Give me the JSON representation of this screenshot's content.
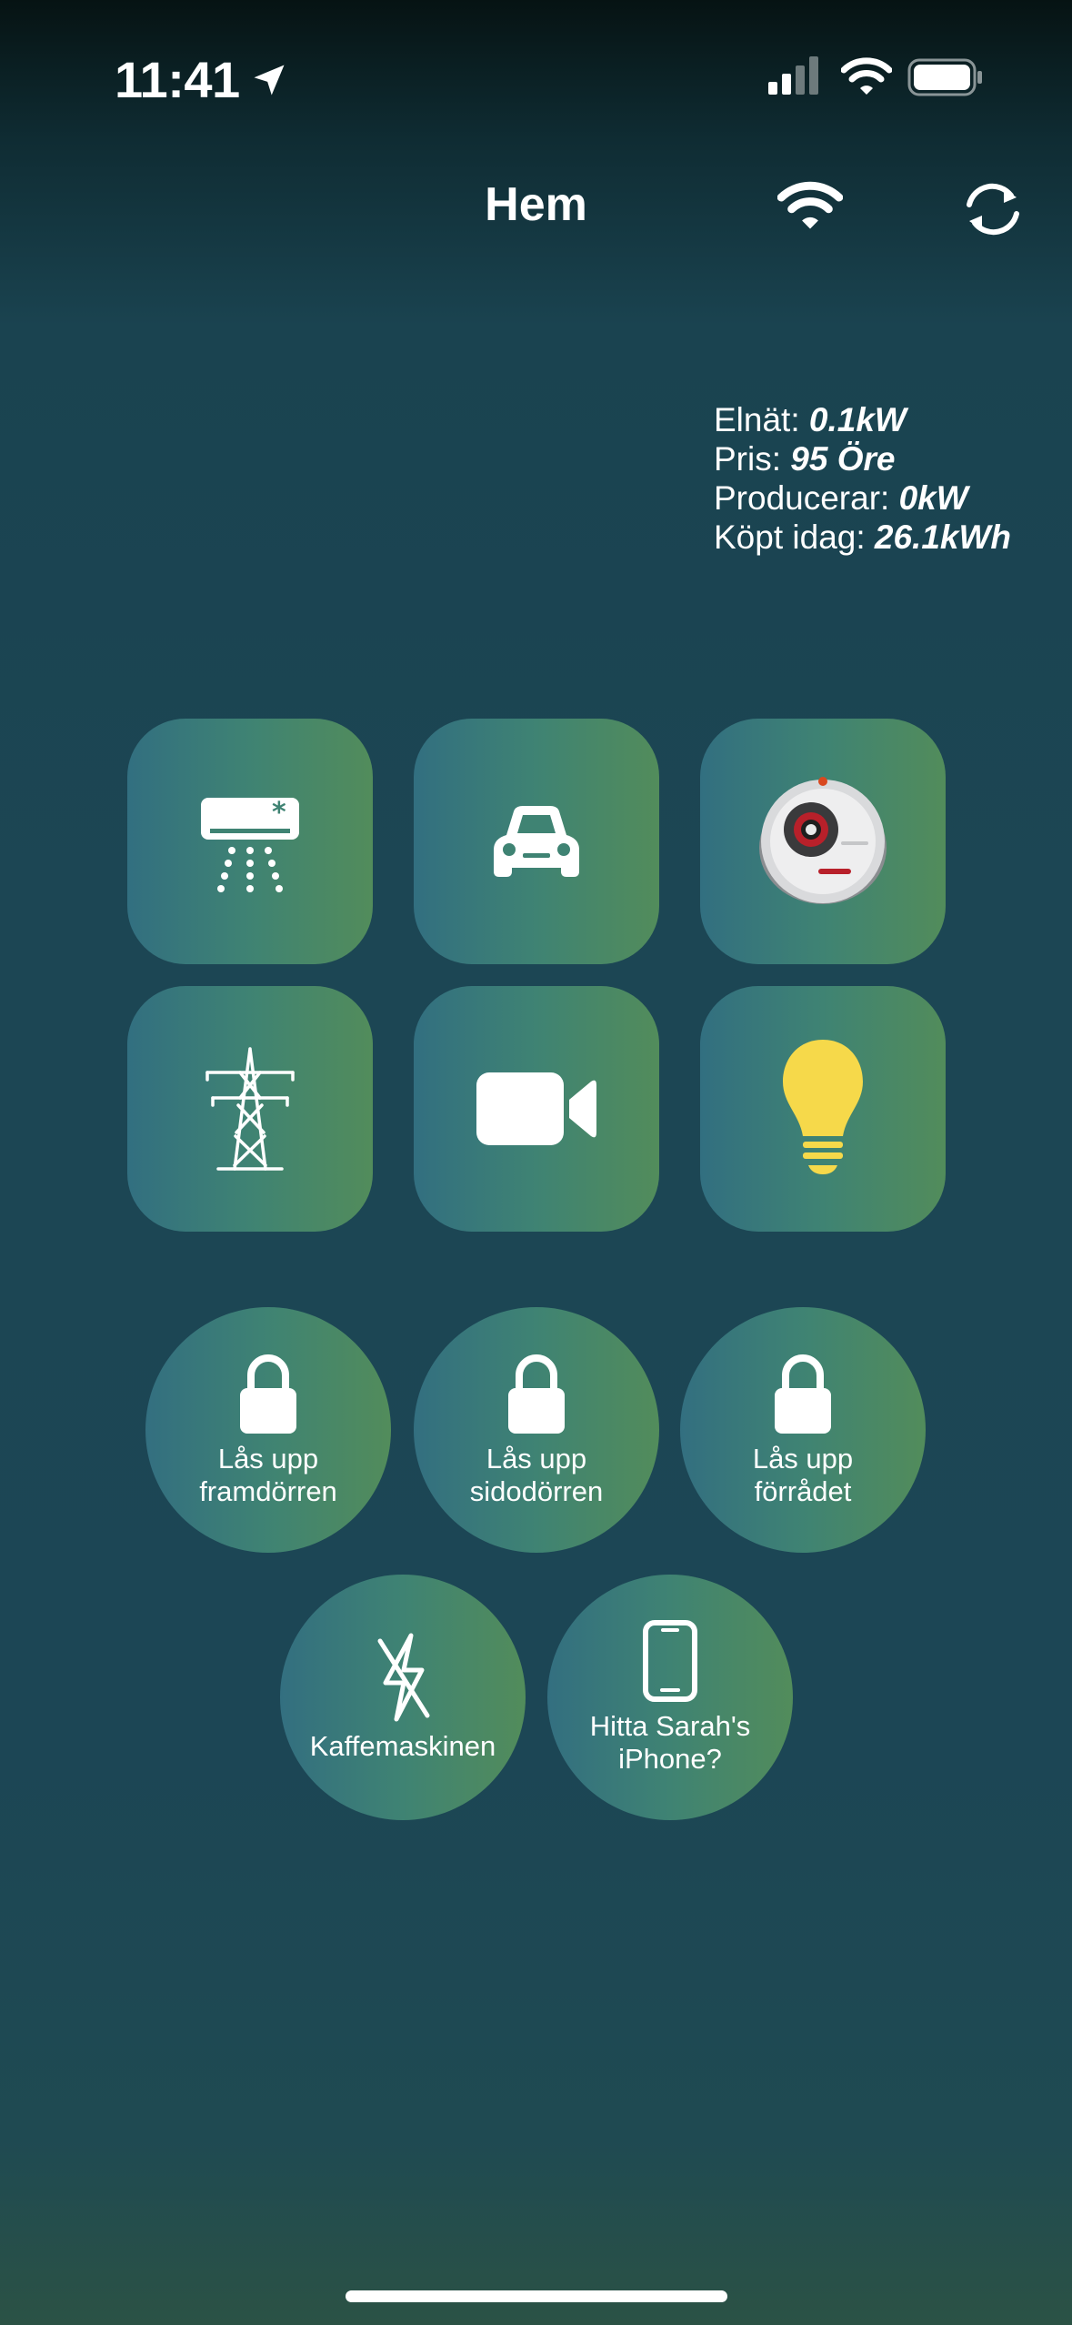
{
  "status_bar": {
    "time": "11:41",
    "icons": [
      "location-arrow-icon",
      "cellular-signal-icon",
      "wifi-icon",
      "battery-icon"
    ]
  },
  "header": {
    "title": "Hem",
    "wifi_icon": "wifi-icon",
    "refresh_icon": "refresh-icon"
  },
  "energy": {
    "grid_label": "Elnät: ",
    "grid_value": "0.1kW",
    "price_label": "Pris: ",
    "price_value": "95 Öre",
    "producing_label": "Producerar: ",
    "producing_value": "0kW",
    "bought_label": "Köpt idag: ",
    "bought_value": "26.1kWh"
  },
  "tiles": [
    {
      "icon": "air-conditioner-icon"
    },
    {
      "icon": "car-icon"
    },
    {
      "icon": "robot-vacuum-icon"
    },
    {
      "icon": "power-pylon-icon"
    },
    {
      "icon": "video-camera-icon"
    },
    {
      "icon": "light-bulb-icon"
    }
  ],
  "actions": {
    "front_door": {
      "line1": "Lås upp",
      "line2": "framdörren",
      "icon": "lock-icon"
    },
    "side_door": {
      "line1": "Lås upp",
      "line2": "sidodörren",
      "icon": "lock-icon"
    },
    "storage": {
      "line1": "Lås upp",
      "line2": "förrådet",
      "icon": "lock-icon"
    },
    "coffee": {
      "label": "Kaffemaskinen",
      "icon": "power-off-icon"
    },
    "find_phone": {
      "line1": "Hitta Sarah's",
      "line2": "iPhone?",
      "icon": "phone-icon"
    }
  },
  "colors": {
    "tile_gradient_start": "#326f80",
    "tile_gradient_end": "#528c5b",
    "bulb": "#f6d94a"
  }
}
